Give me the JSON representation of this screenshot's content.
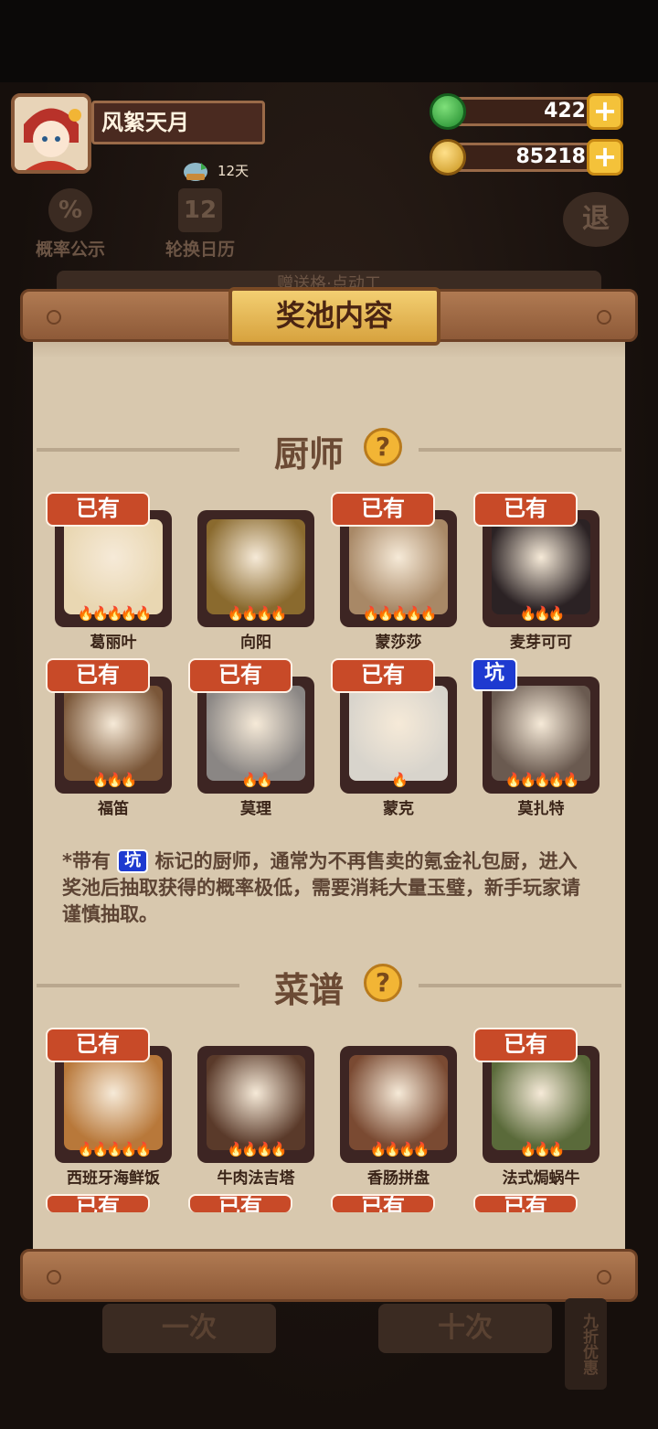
{
  "profile": {
    "name": "风絮天月",
    "level_days": "12天"
  },
  "currencies": {
    "jade": "422",
    "coins": "85218"
  },
  "background": {
    "prob_label": "概率公示",
    "rotation_label": "轮换日历",
    "exit_label": "退",
    "calendar_num": "12",
    "banner_text": "赠送格·点动工",
    "draw_one": "一次",
    "draw_ten": "十次",
    "discount": "九折优惠"
  },
  "panel": {
    "title": "奖池内容",
    "chef_section": "厨师",
    "recipe_section": "菜谱",
    "help": "?",
    "owned_badge": "已有",
    "pit_badge": "坑",
    "note_prefix": "*带有",
    "note_body": "标记的厨师，通常为不再售卖的氪金礼包厨，进入奖池后抽取获得的概率极低，需要消耗大量玉璧，新手玩家请谨慎抽取。"
  },
  "chefs": [
    {
      "name": "葛丽叶",
      "owned": true,
      "stars": 5,
      "art": "#e9d7b2"
    },
    {
      "name": "向阳",
      "owned": false,
      "stars": 4,
      "art": "#8a6a2e"
    },
    {
      "name": "蒙莎莎",
      "owned": true,
      "stars": 5,
      "art": "#a88866"
    },
    {
      "name": "麦芽可可",
      "owned": true,
      "stars": 3,
      "art": "#2b2224"
    },
    {
      "name": "福笛",
      "owned": true,
      "stars": 3,
      "art": "#7a5638"
    },
    {
      "name": "莫理",
      "owned": true,
      "stars": 2,
      "art": "#8a8684"
    },
    {
      "name": "蒙克",
      "owned": true,
      "stars": 1,
      "art": "#d8d4cc"
    },
    {
      "name": "莫扎特",
      "owned": false,
      "pit": true,
      "stars": 5,
      "art": "#6a5a50"
    }
  ],
  "recipes": [
    {
      "name": "西班牙海鲜饭",
      "owned": true,
      "stars": 5,
      "art": "#b8783a"
    },
    {
      "name": "牛肉法吉塔",
      "owned": false,
      "stars": 4,
      "art": "#5a3a2a"
    },
    {
      "name": "香肠拼盘",
      "owned": false,
      "stars": 4,
      "art": "#7a4a32"
    },
    {
      "name": "法式焗蜗牛",
      "owned": true,
      "stars": 3,
      "art": "#5a6a3a"
    }
  ],
  "colors": {
    "owned_badge": "#c84a28",
    "pit_badge": "#1e3ad0",
    "panel": "#d8c8ae",
    "card": "#3d2523"
  }
}
